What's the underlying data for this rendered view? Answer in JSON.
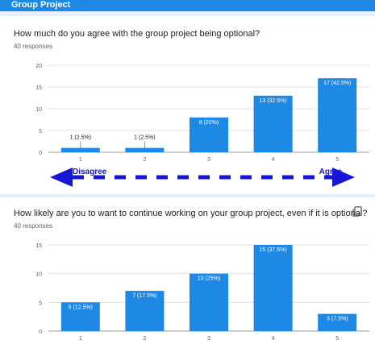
{
  "header": {
    "title": "Group Project"
  },
  "questions": [
    {
      "text": "How much do you agree with the group project being optional?",
      "responses": "40 responses"
    },
    {
      "text": "How likely are you to want to continue working on your group project, even if it is optional?",
      "responses": "40 responses"
    }
  ],
  "annotation": {
    "left_label": "Disagree",
    "right_label": "Agree",
    "arrow_color": "#1616d4"
  },
  "colors": {
    "bar": "#1e88e5",
    "header": "#1e88e5",
    "background": "#e8f0fe"
  },
  "icons": {
    "copy": "copy-icon"
  },
  "chart_data": [
    {
      "type": "bar",
      "categories": [
        "1",
        "2",
        "3",
        "4",
        "5"
      ],
      "values": [
        1,
        1,
        8,
        13,
        17
      ],
      "data_labels": [
        "1 (2.5%)",
        "1 (2.5%)",
        "8 (20%)",
        "13 (32.5%)",
        "17 (42.5%)"
      ],
      "yticks": [
        0,
        5,
        10,
        15,
        20
      ],
      "ylim": [
        0,
        20
      ],
      "grid": true
    },
    {
      "type": "bar",
      "categories": [
        "1",
        "2",
        "3",
        "4",
        "5"
      ],
      "values": [
        5,
        7,
        10,
        15,
        3
      ],
      "data_labels": [
        "5 (12.5%)",
        "7 (17.5%)",
        "10 (25%)",
        "15 (37.5%)",
        "3 (7.5%)"
      ],
      "yticks": [
        0,
        5,
        10,
        15
      ],
      "ylim": [
        0,
        15
      ],
      "grid": true
    }
  ]
}
